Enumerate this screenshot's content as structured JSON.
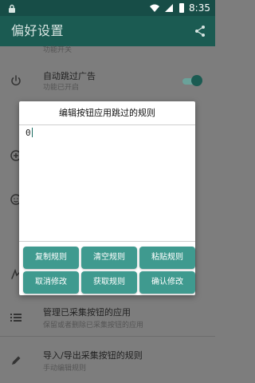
{
  "status_bar": {
    "time": "8:35"
  },
  "app_bar": {
    "title": "偏好设置",
    "share_icon": "share-icon"
  },
  "settings": {
    "item_top_subtitle": "功能开关",
    "auto_skip": {
      "title": "自动跳过广告",
      "subtitle": "功能已开启",
      "toggle_on": true
    },
    "manage_buttons": {
      "title": "管理已采集按钮的应用",
      "subtitle": "保留或者删除已采集按钮的应用"
    },
    "import_export": {
      "title": "导入/导出采集按钮的规则",
      "subtitle": "手动编辑规则"
    }
  },
  "dialog": {
    "title": "编辑按钮应用跳过的规则",
    "content": "0",
    "buttons": [
      "复制规则",
      "清空规则",
      "粘贴规则",
      "取消修改",
      "获取规则",
      "确认修改"
    ]
  },
  "colors": {
    "status_bar": "#174d47",
    "app_bar": "#1b5b52",
    "accent": "#3f9a8f",
    "overlay": "#7d7d7d"
  }
}
